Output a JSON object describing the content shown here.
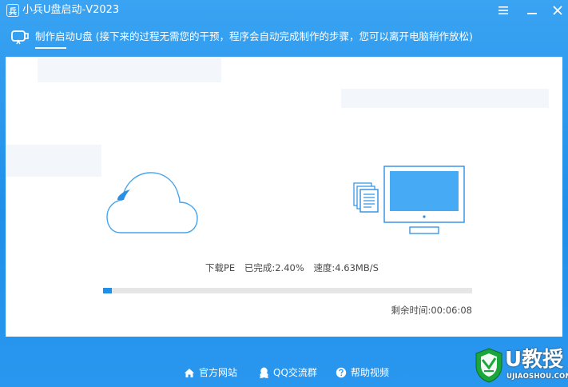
{
  "window": {
    "title": "小兵U盘启动-V2023",
    "logo_glyph": "兵",
    "controls": {
      "menu_icon": "hamburger-menu-icon",
      "minimize_icon": "minimize-icon",
      "close_icon": "close-icon"
    }
  },
  "step": {
    "icon": "usb-drive-icon",
    "text": "制作启动U盘 (接下来的过程无需您的干预，程序会自动完成制作的步骤，您可以离开电脑稍作放松)"
  },
  "progress": {
    "stage_label": "下载PE",
    "completed_label": "已完成:2.40%",
    "completed_fraction": 0.024,
    "speed_label": "速度:4.63MB/S",
    "remaining_label": "剩余时间:00:06:08"
  },
  "illustration": {
    "source_icon": "cloud-icon",
    "files_icon": "documents-icon",
    "target_icon": "monitor-icon"
  },
  "footer": {
    "links": [
      {
        "label": "官方网站",
        "icon": "home-icon"
      },
      {
        "label": "QQ交流群",
        "icon": "qq-penguin-icon"
      },
      {
        "label": "帮助视频",
        "icon": "help-icon"
      }
    ]
  },
  "watermark": {
    "brand": "U教授",
    "domain": "UJIAOSHOU.COM"
  },
  "colors": {
    "accent": "#1f8fe9",
    "background": "#2a97ef",
    "panel": "#ffffff",
    "track": "#e6e6e6"
  }
}
